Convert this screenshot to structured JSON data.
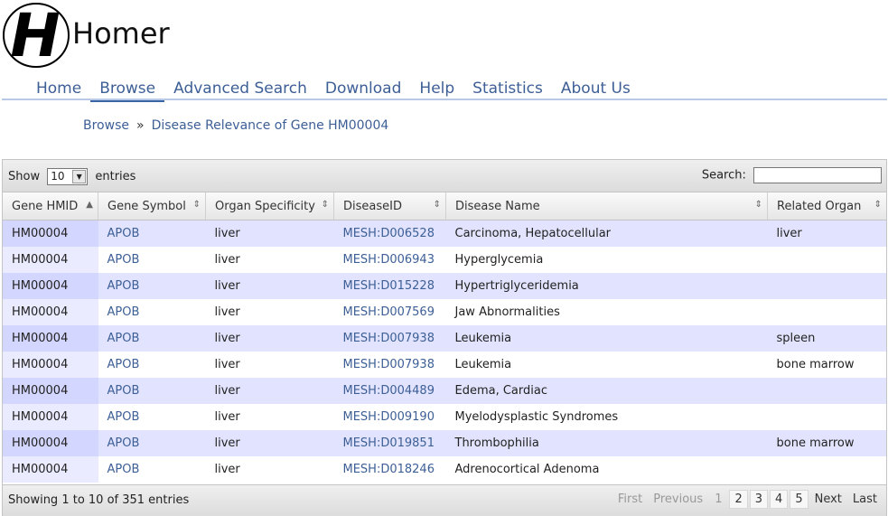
{
  "app": {
    "logo_letter": "H",
    "title": "Homer"
  },
  "nav": [
    "Home",
    "Browse",
    "Advanced Search",
    "Download",
    "Help",
    "Statistics",
    "About Us"
  ],
  "breadcrumb": {
    "root": "Browse",
    "sep": "»",
    "current": "Disease Relevance of Gene HM00004"
  },
  "table": {
    "show_label": "Show",
    "show_value": "10",
    "entries_label": "entries",
    "search_label": "Search:",
    "search_value": "",
    "columns": [
      "Gene HMID",
      "Gene Symbol",
      "Organ Specificity",
      "DiseaseID",
      "Disease Name",
      "Related Organ"
    ],
    "rows": [
      [
        "HM00004",
        "APOB",
        "liver",
        "MESH:D006528",
        "Carcinoma, Hepatocellular",
        "liver"
      ],
      [
        "HM00004",
        "APOB",
        "liver",
        "MESH:D006943",
        "Hyperglycemia",
        ""
      ],
      [
        "HM00004",
        "APOB",
        "liver",
        "MESH:D015228",
        "Hypertriglyceridemia",
        ""
      ],
      [
        "HM00004",
        "APOB",
        "liver",
        "MESH:D007569",
        "Jaw Abnormalities",
        ""
      ],
      [
        "HM00004",
        "APOB",
        "liver",
        "MESH:D007938",
        "Leukemia",
        "spleen"
      ],
      [
        "HM00004",
        "APOB",
        "liver",
        "MESH:D007938",
        "Leukemia",
        "bone marrow"
      ],
      [
        "HM00004",
        "APOB",
        "liver",
        "MESH:D004489",
        "Edema, Cardiac",
        ""
      ],
      [
        "HM00004",
        "APOB",
        "liver",
        "MESH:D009190",
        "Myelodysplastic Syndromes",
        ""
      ],
      [
        "HM00004",
        "APOB",
        "liver",
        "MESH:D019851",
        "Thrombophilia",
        "bone marrow"
      ],
      [
        "HM00004",
        "APOB",
        "liver",
        "MESH:D018246",
        "Adrenocortical Adenoma",
        ""
      ]
    ],
    "info": "Showing 1 to 10 of 351 entries",
    "pagination": [
      "First",
      "Previous",
      "1",
      "2",
      "3",
      "4",
      "5",
      "Next",
      "Last"
    ]
  }
}
